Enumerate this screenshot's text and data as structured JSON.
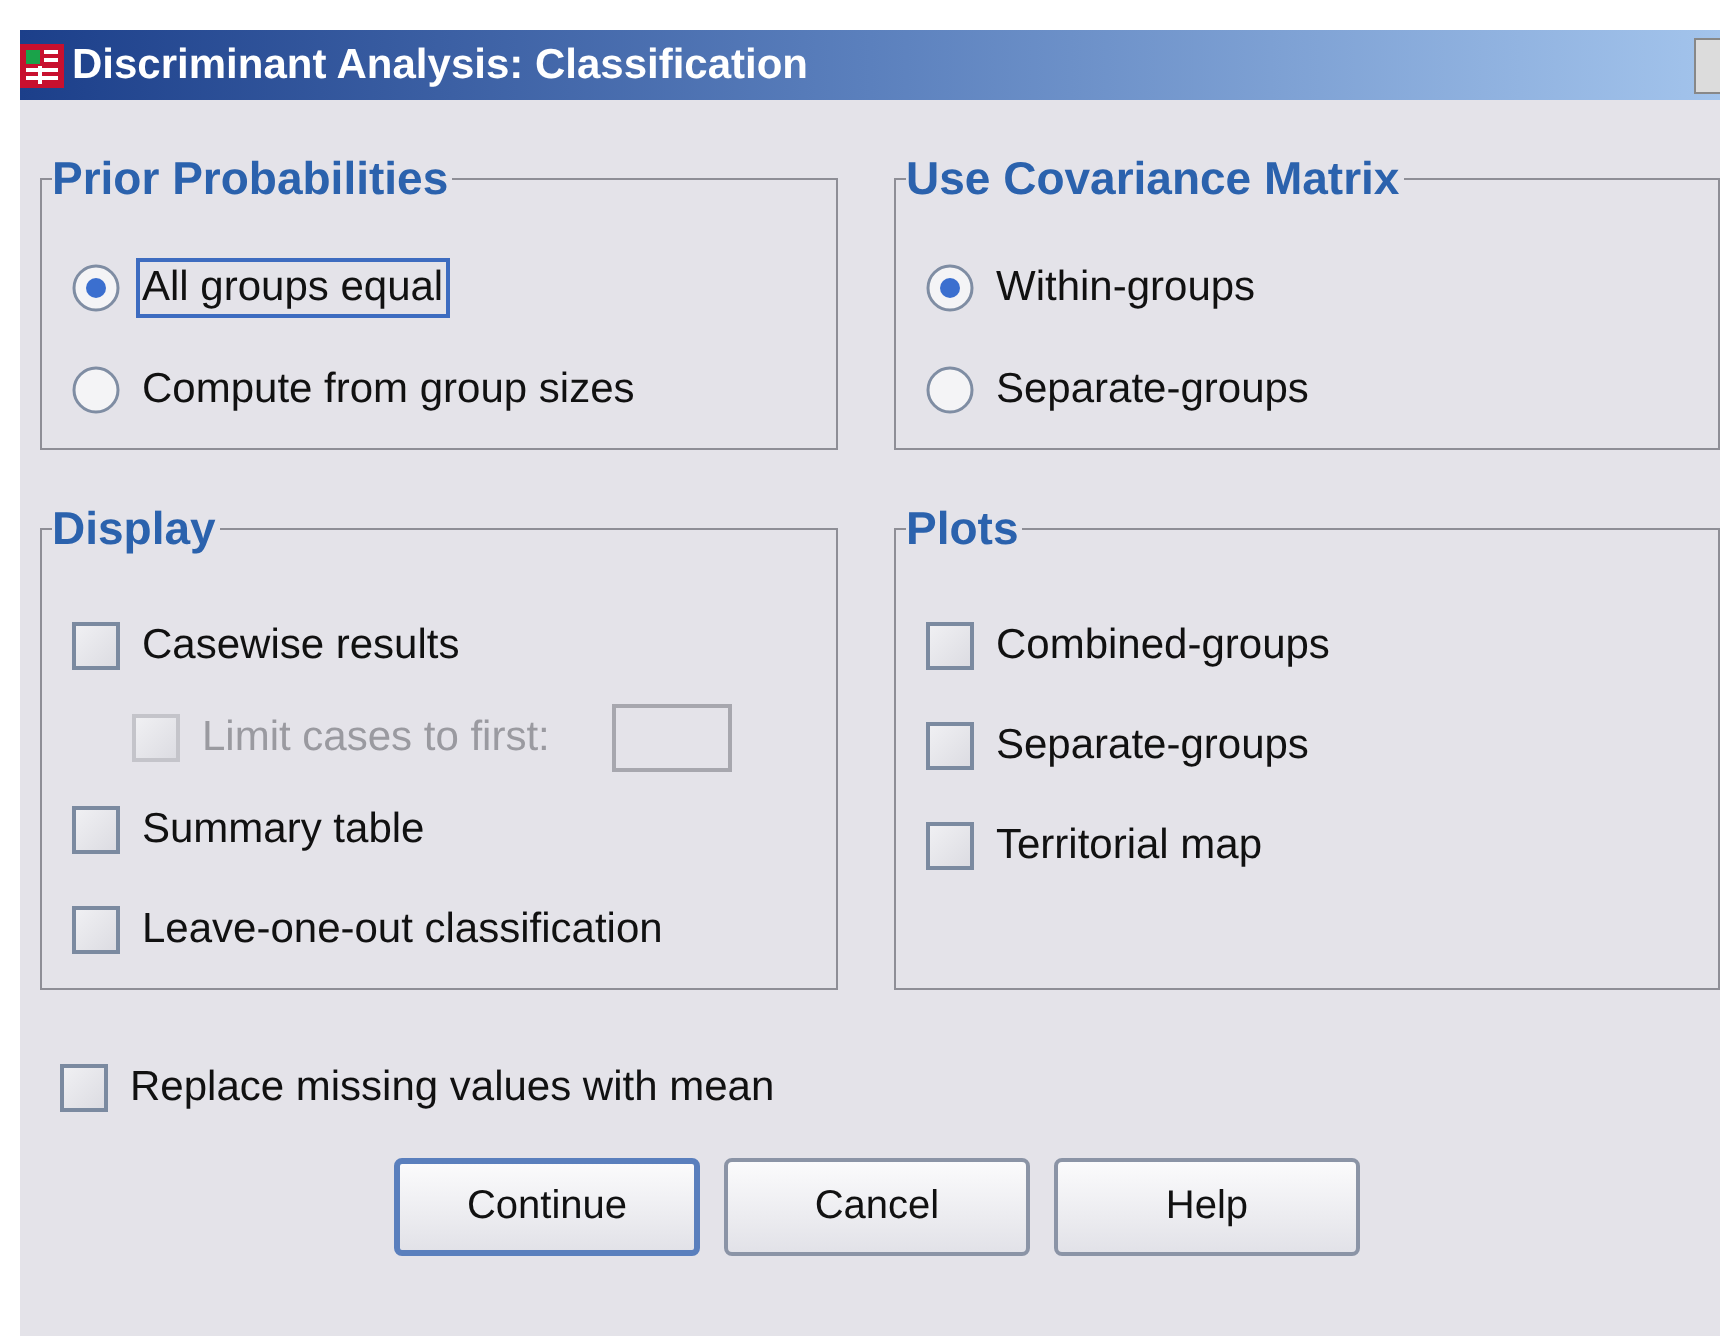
{
  "window": {
    "title": "Discriminant Analysis: Classification"
  },
  "groups": [
    {
      "title": "Prior Probabilities",
      "kind": "radio",
      "options": [
        {
          "label": "All groups equal",
          "selected": true,
          "focused": true
        },
        {
          "label": "Compute from group sizes",
          "selected": false,
          "focused": false
        }
      ]
    },
    {
      "title": "Use Covariance Matrix",
      "kind": "radio",
      "options": [
        {
          "label": "Within-groups",
          "selected": true,
          "focused": false
        },
        {
          "label": "Separate-groups",
          "selected": false,
          "focused": false
        }
      ]
    },
    {
      "title": "Display",
      "kind": "check",
      "options": [
        {
          "kind": "check",
          "label": "Casewise results",
          "checked": false,
          "disabled": false
        },
        {
          "kind": "sub_check_with_field",
          "label": "Limit cases to first:",
          "checked": false,
          "disabled": true
        },
        {
          "kind": "check",
          "label": "Summary table",
          "checked": false,
          "disabled": false
        },
        {
          "kind": "check",
          "label": "Leave-one-out classification",
          "checked": false,
          "disabled": false
        }
      ]
    },
    {
      "title": "Plots",
      "kind": "check",
      "options": [
        {
          "kind": "check",
          "label": "Combined-groups",
          "checked": false,
          "disabled": false
        },
        {
          "kind": "check",
          "label": "Separate-groups",
          "checked": false,
          "disabled": false
        },
        {
          "kind": "check",
          "label": "Territorial map",
          "checked": false,
          "disabled": false
        }
      ]
    }
  ],
  "replace_missing": {
    "label": "Replace missing values with mean",
    "checked": false
  },
  "buttons": [
    {
      "label": "Continue",
      "default": true
    },
    {
      "label": "Cancel",
      "default": false
    },
    {
      "label": "Help",
      "default": false
    }
  ]
}
